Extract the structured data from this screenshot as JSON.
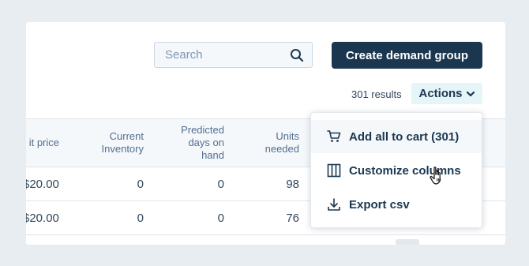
{
  "search": {
    "placeholder": "Search",
    "icon": "search-icon"
  },
  "toolbar": {
    "create_label": "Create demand group",
    "results_text": "301 results",
    "actions_label": "Actions",
    "actions_icon": "chevron-down-icon"
  },
  "table": {
    "headers": {
      "price": "it price",
      "inventory_line1": "Current",
      "inventory_line2": "Inventory",
      "predicted_line1": "Predicted",
      "predicted_line2": "days on",
      "predicted_line3": "hand",
      "units_line1": "Units",
      "units_line2": "needed"
    },
    "rows": [
      {
        "price": "$20.00",
        "inventory": "0",
        "predicted": "0",
        "units": "98"
      },
      {
        "price": "$20.00",
        "inventory": "0",
        "predicted": "0",
        "units": "76"
      }
    ]
  },
  "menu": {
    "items": [
      {
        "label": "Add all to cart (301)",
        "icon": "cart-icon"
      },
      {
        "label": "Customize columns",
        "icon": "columns-icon"
      },
      {
        "label": "Export csv",
        "icon": "download-icon"
      }
    ]
  },
  "colors": {
    "primary_button": "#1b3750",
    "actions_bg": "#e5f5f8",
    "page_bg": "#e8edf2"
  }
}
